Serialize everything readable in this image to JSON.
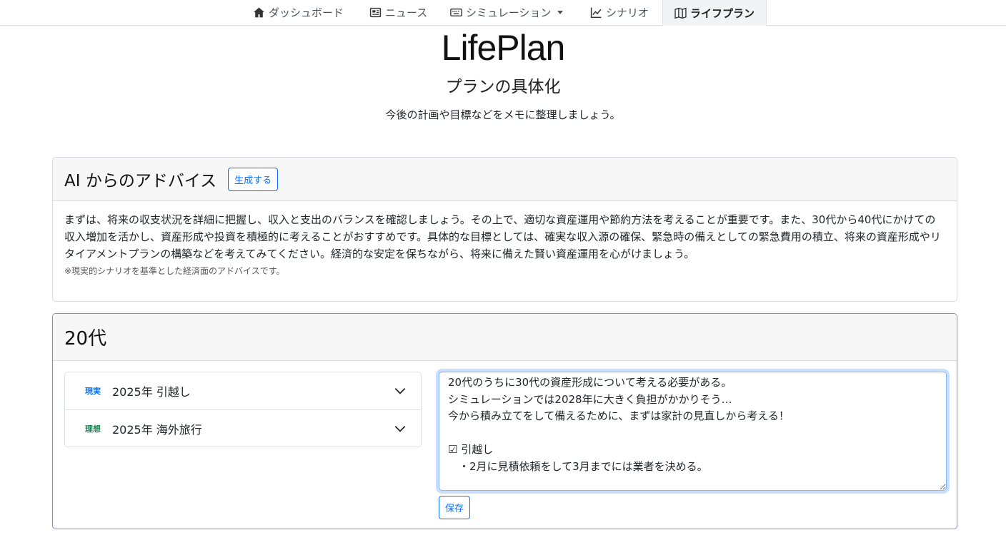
{
  "nav": {
    "items": [
      {
        "label": "ダッシュボード",
        "icon": "house-icon"
      },
      {
        "label": "ニュース",
        "icon": "newspaper-icon"
      },
      {
        "label": "シミュレーション",
        "icon": "keyboard-icon"
      },
      {
        "label": "シナリオ",
        "icon": "graph-up-icon"
      },
      {
        "label": "ライフプラン",
        "icon": "map-icon",
        "active": true
      }
    ]
  },
  "header": {
    "title": "LifePlan",
    "subtitle": "プランの具体化",
    "description": "今後の計画や目標などをメモに整理しましょう。"
  },
  "advice": {
    "title": "AI からのアドバイス",
    "generate_label": "生成する",
    "body": "まずは、将来の収支状況を詳細に把握し、収入と支出のバランスを確認しましょう。その上で、適切な資産運用や節約方法を考えることが重要です。また、30代から40代にかけての収入増加を活かし、資産形成や投資を積極的に考えることがおすすめです。具体的な目標としては、確実な収入源の確保、緊急時の備えとしての緊急費用の積立、将来の資産形成やリタイアメントプランの構築などを考えてみてください。経済的な安定を保ちながら、将来に備えた賢い資産運用を心がけましょう。",
    "note": "※現実的シナリオを基準とした経済面のアドバイスです。"
  },
  "decade": {
    "title": "20代",
    "events": [
      {
        "badge": "現実",
        "badge_color": "#0d6efd",
        "label": "2025年 引越し"
      },
      {
        "badge": "理想",
        "badge_color": "#198754",
        "label": "2025年 海外旅行"
      }
    ],
    "memo": "20代のうちに30代の資産形成について考える必要がある。\nシミュレーションでは2028年に大きく負担がかかりそう…\n今から積み立てをして備えるために、まずは家計の見直しから考える！\n\n☑ 引越し\n　・2月に見積依頼をして3月までには業者を決める。",
    "save_label": "保存"
  }
}
